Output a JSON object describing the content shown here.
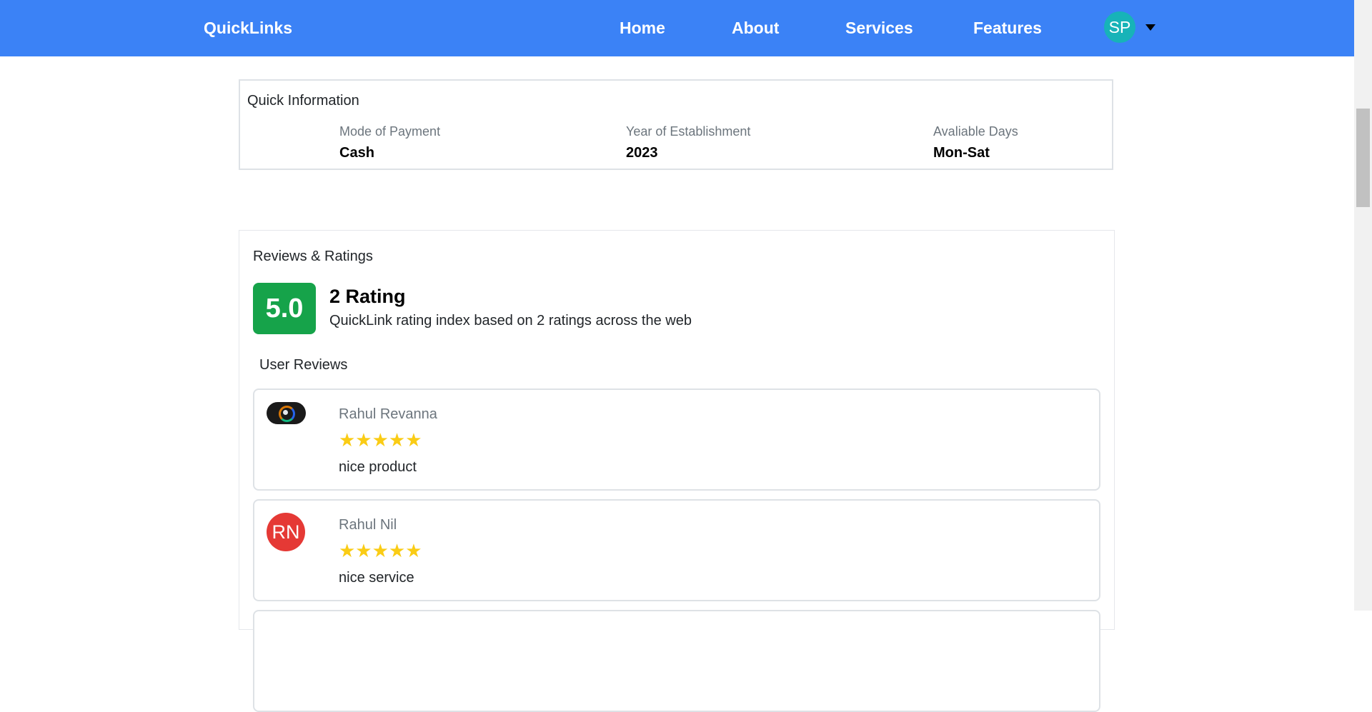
{
  "navbar": {
    "brand": "QuickLinks",
    "links": [
      "Home",
      "About",
      "Services",
      "Features"
    ],
    "user_initials": "SP",
    "bg_color": "#3b82f6"
  },
  "quick_info": {
    "title": "Quick Information",
    "items": [
      {
        "label": "Mode of Payment",
        "value": "Cash"
      },
      {
        "label": "Year of Establishment",
        "value": "2023"
      },
      {
        "label": "Avaliable Days",
        "value": "Mon-Sat"
      }
    ]
  },
  "reviews": {
    "title": "Reviews & Ratings",
    "score": "5.0",
    "score_color": "#16a34a",
    "rating_heading": "2 Rating",
    "rating_sub": "QuickLink rating index based on 2 ratings across the web",
    "user_reviews_title": "User Reviews",
    "items": [
      {
        "name": "Rahul Revanna",
        "stars": "★★★★★",
        "rating": 5,
        "text": "nice product",
        "avatar": "image"
      },
      {
        "name": "Rahul Nil",
        "stars": "★★★★★",
        "rating": 5,
        "text": "nice service",
        "avatar_initials": "RN",
        "avatar_color": "#e53935"
      }
    ]
  }
}
